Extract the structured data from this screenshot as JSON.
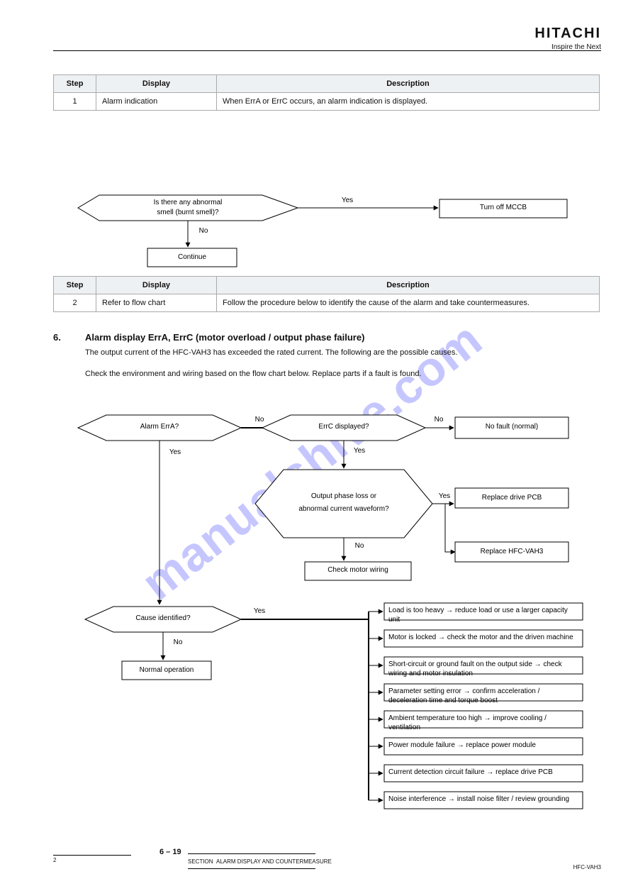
{
  "brand": {
    "wordmark": "HITACHI",
    "tagline": "Inspire the Next"
  },
  "watermark": "manualshive.com",
  "table1": {
    "headers": [
      "Step",
      "Display",
      "Description"
    ],
    "rows": [
      {
        "step": "1",
        "display": "Alarm indication",
        "description": "When ErrA or ErrC occurs, an alarm indication is displayed."
      }
    ]
  },
  "flow1": {
    "decision": {
      "label_top": "Is there any abnormal",
      "label_bottom": "smell (burnt smell)?",
      "edge_right": "Yes",
      "edge_down": "No"
    },
    "right_box": "Turn off MCCB",
    "down_box": "Continue"
  },
  "table2": {
    "headers": [
      "Step",
      "Display",
      "Description"
    ],
    "rows": [
      {
        "step": "2",
        "display": "Refer to flow chart",
        "description": "Follow the procedure below to identify the cause of the alarm and take countermeasures."
      }
    ]
  },
  "section": {
    "number": "6.",
    "title": "Alarm display ErrA, ErrC (motor overload / output phase failure)"
  },
  "intro": {
    "p1": "The output current of the HFC-VAH3 has exceeded the rated current. The following are the possible causes.",
    "p2": "Check the environment and wiring based on the flow chart below. Replace parts if a fault is found."
  },
  "flow2": {
    "d1": {
      "text": "Alarm ErrA?",
      "edge_right": "No",
      "edge_down": "Yes"
    },
    "d2": {
      "text": "ErrC displayed?",
      "edge_right": "No",
      "edge_down": "Yes"
    },
    "box_r1": "No fault (normal)",
    "d3": {
      "text_top": "Output phase loss or",
      "text_bot": "abnormal current waveform?",
      "edge_right": "Yes",
      "edge_down": "No"
    },
    "box_r2": "Replace drive PCB",
    "box_r3": "Replace HFC-VAH3",
    "box_checkmotor": "Check motor wiring",
    "d4": {
      "text": "Cause identified?",
      "edge_right": "Yes",
      "edge_down": "No"
    },
    "box_normal": "Normal operation",
    "list": [
      "Load is too heavy → reduce load or use a larger capacity unit",
      "Motor is locked → check the motor and the driven machine",
      "Short-circuit or ground fault on the output side → check wiring and motor insulation",
      "Parameter setting error → confirm acceleration / deceleration time and torque boost",
      "Ambient temperature too high → improve cooling / ventilation",
      "Power module failure → replace power module",
      "Current detection circuit failure → replace drive PCB",
      "Noise interference → install noise filter / review grounding"
    ]
  },
  "footer": {
    "supnote": "2",
    "sect": "SECTION",
    "sect_title": "ALARM DISPLAY AND COUNTERMEASURE",
    "ref": "HFC-VAH3",
    "page": "6 – 19"
  }
}
